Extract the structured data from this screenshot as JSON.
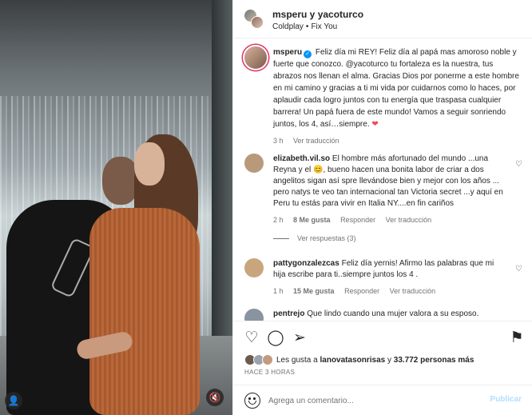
{
  "header": {
    "users": "msperu y yacoturco",
    "song_artist": "Coldplay",
    "song_separator": "•",
    "song_title": "Fix You"
  },
  "caption": {
    "username": "msperu",
    "verified_glyph": "✓",
    "text": "Feliz día mi REY! Feliz día al papá mas amoroso noble y fuerte que conozco. @yacoturco tu fortaleza es la nuestra, tus abrazos nos llenan el alma. Gracias Dios por ponerme a este hombre en mi camino y gracias a ti mi vida por cuidarnos como lo haces, por aplaudir cada logro juntos con tu energía que traspasa cualquier barrera! Un papá fuera de este mundo! Vamos a seguir sonriendo juntos, los 4, así…siempre.",
    "heart": "❤",
    "time": "3 h",
    "see_translation": "Ver traducción"
  },
  "comments": [
    {
      "username": "elizabeth.vil.so",
      "text_before_emoji": "El hombre más afortunado del mundo ...una Reyna y el",
      "emoji": "😊",
      "text_after_emoji": ", bueno hacen una bonita labor de criar a dos angelitos sigan así spre llevándose bien y mejor con los años ... pero natys te veo tan internacional tan Victoria secret ...y aquí en Peru tu estás para vivir en Italia NY....en fin cariños",
      "time": "2 h",
      "likes": "8 Me gusta",
      "reply": "Responder",
      "translate": "Ver traducción",
      "view_replies": "Ver respuestas (3)",
      "avatar_color": "#b89a7a"
    },
    {
      "username": "pattygonzalezcas",
      "text": "Feliz día yernis! Afirmo las palabras que mi hija escribe para ti..siempre juntos los 4 .",
      "time": "1 h",
      "likes": "15 Me gusta",
      "reply": "Responder",
      "translate": "Ver traducción",
      "avatar_color": "#c9a57e"
    },
    {
      "username": "pentrejo",
      "text": "Que lindo cuando una mujer valora a su esposo.",
      "avatar_color": "#8a94a0"
    }
  ],
  "actions": {
    "like_icon": "♡",
    "comment_icon": "◯",
    "share_icon": "➢",
    "save_icon": "⚑"
  },
  "likes": {
    "prefix": "Les gusta a",
    "user": "lanovatasonrisas",
    "conjunction": "y",
    "count": "33.772 personas más"
  },
  "time_ago": "HACE 3 HORAS",
  "add_comment": {
    "placeholder": "Agrega un comentario...",
    "publish": "Publicar"
  },
  "photo": {
    "user_tag_icon": "👤",
    "mute_icon": "🔇"
  }
}
